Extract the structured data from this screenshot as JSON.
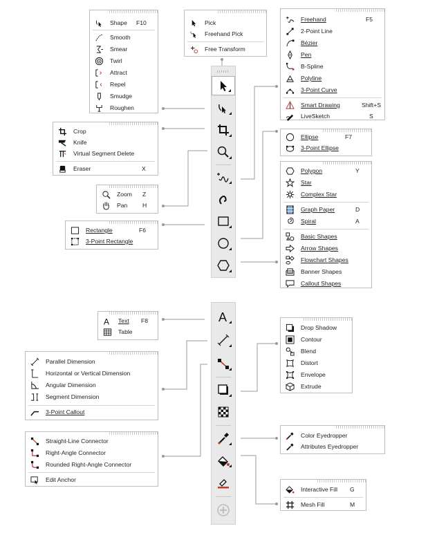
{
  "flyouts": {
    "shape": {
      "items": [
        {
          "label": "Shape",
          "shortcut": "F10",
          "icon": "shape-tool-icon"
        },
        {
          "label": "Smooth",
          "shortcut": "",
          "icon": "smooth-icon"
        },
        {
          "label": "Smear",
          "shortcut": "",
          "icon": "smear-icon"
        },
        {
          "label": "Twirl",
          "shortcut": "",
          "icon": "twirl-icon"
        },
        {
          "label": "Attract",
          "shortcut": "",
          "icon": "attract-icon"
        },
        {
          "label": "Repel",
          "shortcut": "",
          "icon": "repel-icon"
        },
        {
          "label": "Smudge",
          "shortcut": "",
          "icon": "smudge-icon"
        },
        {
          "label": "Roughen",
          "shortcut": "",
          "icon": "roughen-icon"
        }
      ]
    },
    "pick": {
      "items": [
        {
          "label": "Pick",
          "icon": "pick-arrow-icon"
        },
        {
          "label": "Freehand Pick",
          "icon": "freehand-pick-icon"
        },
        {
          "label": "Free Transform",
          "icon": "free-transform-icon"
        }
      ]
    },
    "curve": {
      "items": [
        {
          "label": "Freehand",
          "shortcut": "F5",
          "icon": "freehand-icon"
        },
        {
          "label": "2-Point Line",
          "shortcut": "",
          "icon": "two-point-line-icon"
        },
        {
          "label": "Bézier",
          "shortcut": "",
          "icon": "bezier-icon"
        },
        {
          "label": "Pen",
          "shortcut": "",
          "icon": "pen-icon"
        },
        {
          "label": "B-Spline",
          "shortcut": "",
          "icon": "b-spline-icon"
        },
        {
          "label": "Polyline",
          "shortcut": "",
          "icon": "polyline-icon"
        },
        {
          "label": "3-Point Curve",
          "shortcut": "",
          "icon": "three-point-curve-icon"
        },
        {
          "label": "Smart Drawing",
          "shortcut": "Shift+S",
          "icon": "smart-drawing-icon"
        },
        {
          "label": "LiveSketch",
          "shortcut": "S",
          "icon": "livesketch-icon"
        }
      ]
    },
    "crop": {
      "items": [
        {
          "label": "Crop",
          "shortcut": "",
          "icon": "crop-icon"
        },
        {
          "label": "Knife",
          "shortcut": "",
          "icon": "knife-icon"
        },
        {
          "label": "Virtual Segment Delete",
          "shortcut": "",
          "icon": "virtual-segment-delete-icon"
        },
        {
          "label": "Eraser",
          "shortcut": "X",
          "icon": "eraser-icon"
        }
      ]
    },
    "ellipse": {
      "items": [
        {
          "label": "Ellipse",
          "shortcut": "F7",
          "icon": "ellipse-icon"
        },
        {
          "label": "3-Point Ellipse",
          "shortcut": "",
          "icon": "three-point-ellipse-icon"
        }
      ]
    },
    "zoom": {
      "items": [
        {
          "label": "Zoom",
          "shortcut": "Z",
          "icon": "zoom-icon"
        },
        {
          "label": "Pan",
          "shortcut": "H",
          "icon": "pan-hand-icon"
        }
      ]
    },
    "polygon": {
      "items": [
        {
          "label": "Polygon",
          "shortcut": "Y",
          "icon": "polygon-icon"
        },
        {
          "label": "Star",
          "shortcut": "",
          "icon": "star-icon"
        },
        {
          "label": "Complex Star",
          "shortcut": "",
          "icon": "complex-star-icon"
        },
        {
          "label": "Graph Paper",
          "shortcut": "D",
          "icon": "graph-paper-icon"
        },
        {
          "label": "Spiral",
          "shortcut": "A",
          "icon": "spiral-icon"
        },
        {
          "label": "Basic Shapes",
          "shortcut": "",
          "icon": "basic-shapes-icon"
        },
        {
          "label": "Arrow Shapes",
          "shortcut": "",
          "icon": "arrow-shapes-icon"
        },
        {
          "label": "Flowchart Shapes",
          "shortcut": "",
          "icon": "flowchart-shapes-icon"
        },
        {
          "label": "Banner Shapes",
          "shortcut": "",
          "icon": "banner-shapes-icon"
        },
        {
          "label": "Callout Shapes",
          "shortcut": "",
          "icon": "callout-shapes-icon"
        }
      ]
    },
    "rectangle": {
      "items": [
        {
          "label": "Rectangle",
          "shortcut": "F6",
          "icon": "rectangle-icon"
        },
        {
          "label": "3-Point Rectangle",
          "shortcut": "",
          "icon": "three-point-rectangle-icon"
        }
      ]
    },
    "text": {
      "items": [
        {
          "label": "Text",
          "shortcut": "F8",
          "icon": "text-icon"
        },
        {
          "label": "Table",
          "shortcut": "",
          "icon": "table-icon"
        }
      ]
    },
    "dimension": {
      "items": [
        {
          "label": "Parallel Dimension",
          "icon": "parallel-dimension-icon"
        },
        {
          "label": "Horizontal or Vertical Dimension",
          "icon": "horizontal-vertical-dimension-icon"
        },
        {
          "label": "Angular Dimension",
          "icon": "angular-dimension-icon"
        },
        {
          "label": "Segment Dimension",
          "icon": "segment-dimension-icon"
        },
        {
          "label": "3-Point Callout",
          "icon": "three-point-callout-icon"
        }
      ]
    },
    "effects": {
      "items": [
        {
          "label": "Drop Shadow",
          "icon": "drop-shadow-icon"
        },
        {
          "label": "Contour",
          "icon": "contour-icon"
        },
        {
          "label": "Blend",
          "icon": "blend-icon"
        },
        {
          "label": "Distort",
          "icon": "distort-icon"
        },
        {
          "label": "Envelope",
          "icon": "envelope-icon"
        },
        {
          "label": "Extrude",
          "icon": "extrude-icon"
        }
      ]
    },
    "connector": {
      "items": [
        {
          "label": "Straight-Line Connector",
          "icon": "straight-line-connector-icon"
        },
        {
          "label": "Right-Angle Connector",
          "icon": "right-angle-connector-icon"
        },
        {
          "label": "Rounded Right-Angle Connector",
          "icon": "rounded-right-angle-connector-icon"
        },
        {
          "label": "Edit Anchor",
          "icon": "edit-anchor-icon"
        }
      ]
    },
    "eyedropper": {
      "items": [
        {
          "label": "Color Eyedropper",
          "icon": "color-eyedropper-icon"
        },
        {
          "label": "Attributes Eyedropper",
          "icon": "attributes-eyedropper-icon"
        }
      ]
    },
    "fill": {
      "items": [
        {
          "label": "Interactive Fill",
          "shortcut": "G",
          "icon": "interactive-fill-icon"
        },
        {
          "label": "Mesh Fill",
          "shortcut": "M",
          "icon": "mesh-fill-icon"
        }
      ]
    }
  },
  "colors": {
    "accent": "#c0392b",
    "line": "#9a9a9a",
    "toolbar": "#e9e9e9"
  }
}
